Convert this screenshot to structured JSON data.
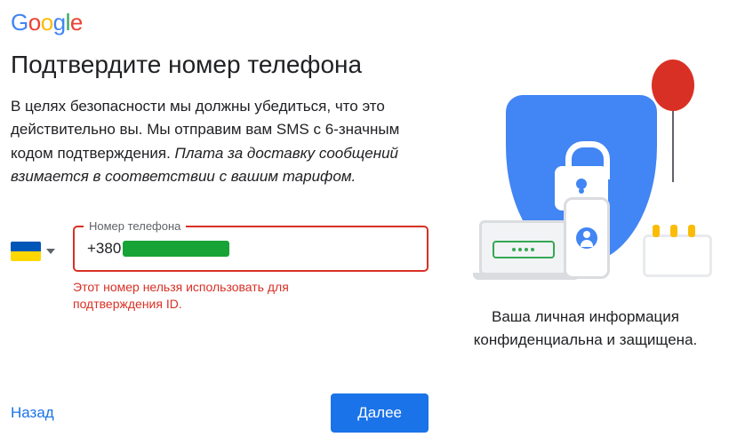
{
  "logo_letters": [
    "G",
    "o",
    "o",
    "g",
    "l",
    "e"
  ],
  "heading": "Подтвердите номер телефона",
  "description_main": "В целях безопасности мы должны убедиться, что это действительно вы. Мы отправим вам SMS с 6-значным кодом подтверждения. ",
  "description_fee": "Плата за доставку сообщений взимается в соответствии с вашим тарифом.",
  "phone_label": "Номер телефона",
  "phone_prefix": "+380",
  "error_text": "Этот номер нельзя использовать для подтверждения ID.",
  "back_label": "Назад",
  "next_label": "Далее",
  "privacy_tagline": "Ваша личная информация конфиденциальна и защищена.",
  "country": "Украина"
}
